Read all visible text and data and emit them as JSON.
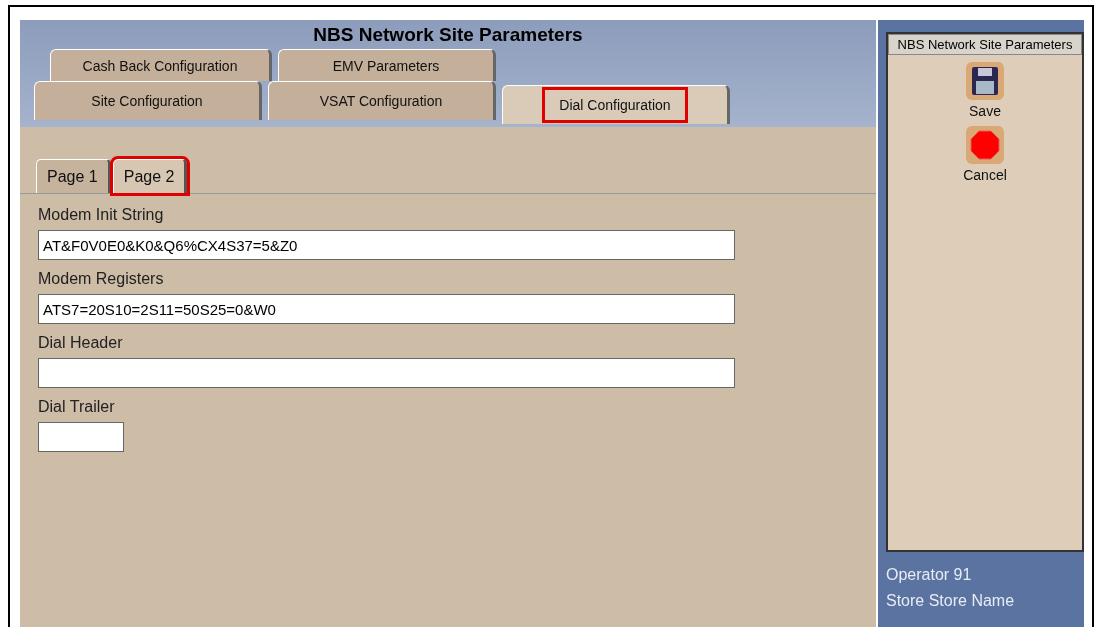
{
  "window": {
    "title": "NBS Network Site Parameters"
  },
  "tab_rows": [
    [
      {
        "label": "Cash Back Configuration",
        "selected": false,
        "highlighted": false
      },
      {
        "label": "EMV Parameters",
        "selected": false,
        "highlighted": false
      }
    ],
    [
      {
        "label": "Site Configuration",
        "selected": false,
        "highlighted": false
      },
      {
        "label": "VSAT Configuration",
        "selected": false,
        "highlighted": false
      },
      {
        "label": "Dial Configuration",
        "selected": true,
        "highlighted": true
      }
    ]
  ],
  "page_tabs": [
    {
      "label": "Page 1",
      "selected": false,
      "highlighted": false
    },
    {
      "label": "Page 2",
      "selected": true,
      "highlighted": true
    }
  ],
  "fields": [
    {
      "label": "Modem Init String",
      "value": "AT&F0V0E0&K0&Q6%CX4S37=5&Z0",
      "kind": "wide"
    },
    {
      "label": "Modem Registers",
      "value": "ATS7=20S10=2S11=50S25=0&W0",
      "kind": "wide"
    },
    {
      "label": "Dial Header",
      "kind": "wide"
    },
    {
      "label": "Dial Trailer",
      "kind": "short"
    }
  ],
  "side_panel": {
    "title": "NBS Network Site Parameters",
    "buttons": [
      {
        "label": "Save",
        "kind": "save"
      },
      {
        "label": "Cancel",
        "kind": "cancel"
      }
    ]
  },
  "status": {
    "operator": "Operator 91",
    "store": "Store Store Name"
  }
}
